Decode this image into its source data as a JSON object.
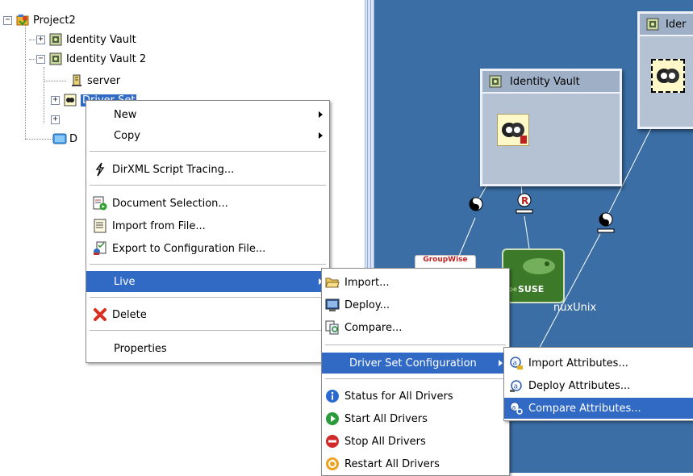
{
  "tree": {
    "items": [
      {
        "label": "Project2"
      },
      {
        "label": "Identity Vault"
      },
      {
        "label": "Identity Vault 2"
      },
      {
        "label": "server"
      },
      {
        "label": "Driver Set"
      },
      {
        "label": "D"
      }
    ]
  },
  "context_menu": {
    "new": "New",
    "copy": "Copy",
    "dirxml_tracing": "DirXML Script Tracing...",
    "document_selection": "Document Selection...",
    "import_from_file": "Import from File...",
    "export_config": "Export to Configuration File...",
    "live": "Live",
    "delete": "Delete",
    "properties": "Properties"
  },
  "live_menu": {
    "import": "Import...",
    "deploy": "Deploy...",
    "compare": "Compare...",
    "driver_set_config": "Driver Set Configuration",
    "status_all": "Status for All Drivers",
    "start_all": "Start All Drivers",
    "stop_all": "Stop All Drivers",
    "restart_all": "Restart All Drivers"
  },
  "dsc_menu": {
    "import_attrs": "Import Attributes...",
    "deploy_attrs": "Deploy Attributes...",
    "compare_attrs": "Compare Attributes..."
  },
  "canvas": {
    "vault1_label": "Identity Vault",
    "vault2_label": "Ider",
    "groupwise_label": "GroupWise",
    "suse_label": "SUSE",
    "suse_prefix": "ope",
    "linuxunix_label": "nuxUnix"
  },
  "colors": {
    "canvas": "#3a6ea5",
    "selection": "#316ac5"
  },
  "icons": [
    "project-icon",
    "identity-vault-icon",
    "server-icon",
    "driver-set-icon",
    "arrow-right-icon",
    "tracing-icon",
    "document-selection-icon",
    "import-file-icon",
    "export-config-icon",
    "delete-x-icon",
    "folder-open-icon",
    "deploy-icon",
    "compare-icon",
    "import-attrs-icon",
    "deploy-attrs-icon",
    "compare-attrs-icon",
    "info-icon",
    "start-icon",
    "stop-icon",
    "restart-icon"
  ]
}
